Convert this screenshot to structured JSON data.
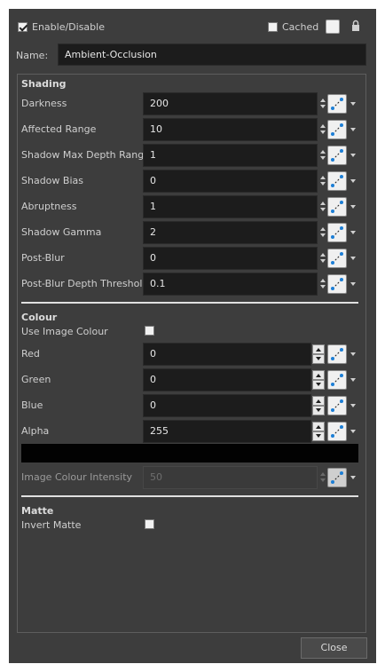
{
  "header": {
    "enable_label": "Enable/Disable",
    "enable_checked": true,
    "cached_label": "Cached",
    "cached_checked": false,
    "lock_icon": "lock-icon"
  },
  "name": {
    "label": "Name:",
    "value": "Ambient-Occlusion"
  },
  "shading": {
    "title": "Shading",
    "rows": [
      {
        "label": "Darkness",
        "value": "200"
      },
      {
        "label": "Affected Range",
        "value": "10"
      },
      {
        "label": "Shadow Max Depth Range",
        "value": "1"
      },
      {
        "label": "Shadow Bias",
        "value": "0"
      },
      {
        "label": "Abruptness",
        "value": "1"
      },
      {
        "label": "Shadow Gamma",
        "value": "2"
      },
      {
        "label": "Post-Blur",
        "value": "0"
      },
      {
        "label": "Post-Blur Depth Threshold",
        "value": "0.1"
      }
    ]
  },
  "colour": {
    "title": "Colour",
    "use_image_colour_label": "Use Image Colour",
    "use_image_colour_checked": false,
    "rows": [
      {
        "label": "Red",
        "value": "0"
      },
      {
        "label": "Green",
        "value": "0"
      },
      {
        "label": "Blue",
        "value": "0"
      },
      {
        "label": "Alpha",
        "value": "255"
      }
    ],
    "swatch_color": "#020202",
    "intensity_label": "Image Colour Intensity",
    "intensity_value": "50"
  },
  "matte": {
    "title": "Matte",
    "invert_label": "Invert Matte",
    "invert_checked": false
  },
  "footer": {
    "close_label": "Close"
  }
}
